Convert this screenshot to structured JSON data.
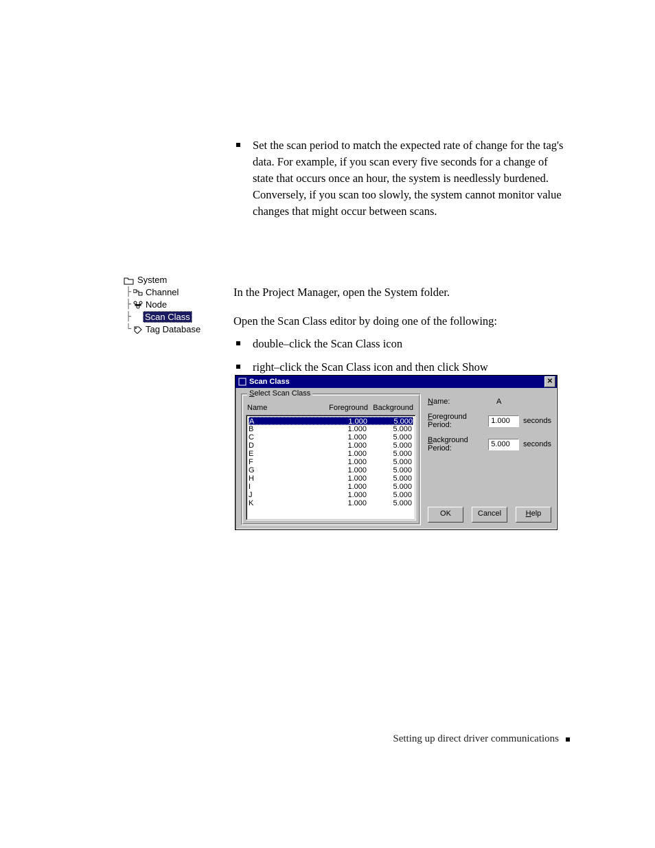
{
  "body": {
    "top_bullet": "Set the scan period to match the expected rate of change for the tag's data. For example, if you scan every five seconds for a change of state that occurs once an hour, the system is needlessly burdened. Conversely, if you scan too slowly, the system cannot monitor value changes that might occur between scans.",
    "para1": "In the Project Manager, open the System folder.",
    "para2": "Open the Scan Class editor by doing one of the following:",
    "sub_bullets": [
      "double–click the Scan Class icon",
      "right–click the Scan Class icon and then click Show"
    ]
  },
  "tree": {
    "root": "System",
    "items": [
      "Channel",
      "Node",
      "Scan Class",
      "Tag Database"
    ],
    "selected_index": 2
  },
  "dialog": {
    "title": "Scan Class",
    "group_legend_prefix": "S",
    "group_legend_rest": "elect Scan Class",
    "headers": {
      "name": "Name",
      "fg": "Foreground",
      "bg": "Background"
    },
    "rows": [
      {
        "name": "A",
        "fg": "1.000",
        "bg": "5.000"
      },
      {
        "name": "B",
        "fg": "1.000",
        "bg": "5.000"
      },
      {
        "name": "C",
        "fg": "1.000",
        "bg": "5.000"
      },
      {
        "name": "D",
        "fg": "1.000",
        "bg": "5.000"
      },
      {
        "name": "E",
        "fg": "1.000",
        "bg": "5.000"
      },
      {
        "name": "F",
        "fg": "1.000",
        "bg": "5.000"
      },
      {
        "name": "G",
        "fg": "1.000",
        "bg": "5.000"
      },
      {
        "name": "H",
        "fg": "1.000",
        "bg": "5.000"
      },
      {
        "name": "I",
        "fg": "1.000",
        "bg": "5.000"
      },
      {
        "name": "J",
        "fg": "1.000",
        "bg": "5.000"
      },
      {
        "name": "K",
        "fg": "1.000",
        "bg": "5.000"
      }
    ],
    "selected_row": 0,
    "right": {
      "name_label_u": "N",
      "name_label_rest": "ame:",
      "name_value": "A",
      "fg_label_u": "F",
      "fg_label_rest": "oreground Period:",
      "fg_value": "1.000",
      "bg_label_u": "B",
      "bg_label_rest": "ackground Period:",
      "bg_value": "5.000",
      "unit": "seconds"
    },
    "buttons": {
      "ok": "OK",
      "cancel": "Cancel",
      "help_u": "H",
      "help_rest": "elp"
    }
  },
  "footer": {
    "text": "Setting up direct driver communications"
  }
}
